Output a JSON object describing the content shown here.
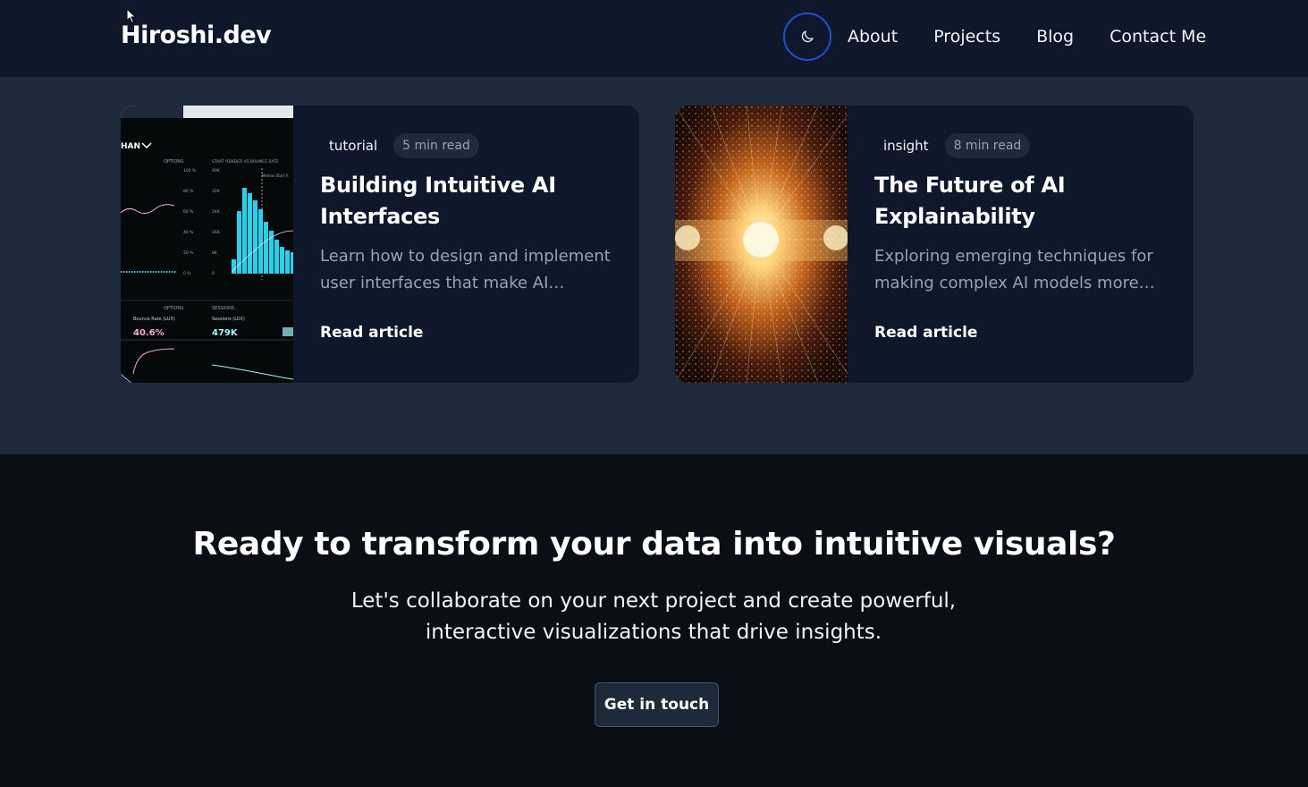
{
  "nav": {
    "brand": "Hiroshi.dev",
    "theme_toggle_icon": "moon-icon",
    "links": [
      {
        "label": "About"
      },
      {
        "label": "Projects"
      },
      {
        "label": "Blog"
      },
      {
        "label": "Contact Me"
      }
    ]
  },
  "articles": [
    {
      "tag": "tutorial",
      "read_time": "5 min read",
      "title": "Building Intuitive AI Interfaces",
      "excerpt": "Learn how to design and implement user interfaces that make AI systems more accessible and understandable.",
      "link_label": "Read article",
      "thumbnail": "analytics-dashboard-image",
      "thumbnail_text": {
        "dropdown": "HAN",
        "options_top": "OPTIONS",
        "chart_title": "START RENDER VS BOUNCE RATE",
        "median": "Median Start R",
        "y_ticks_pct": [
          "100 %",
          "80 %",
          "60 %",
          "40 %",
          "20 %",
          "0 %"
        ],
        "y_ticks_k": [
          "40K",
          "32K",
          "24K",
          "16K",
          "8K",
          "0"
        ],
        "options_bottom": "OPTIONS",
        "sessions": "SESSIONS",
        "bounce_label": "Bounce Rate (LUX)",
        "bounce_value": "40.6%",
        "sessions_label": "Sessions (LUX)",
        "sessions_value": "479K"
      }
    },
    {
      "tag": "insight",
      "read_time": "8 min read",
      "title": "The Future of AI Explainability",
      "excerpt": "Exploring emerging techniques for making complex AI models more transparent and interpretable.",
      "link_label": "Read article",
      "thumbnail": "light-tunnel-image"
    }
  ],
  "cta": {
    "title": "Ready to transform your data into intuitive visuals?",
    "subtitle": "Let's collaborate on your next project and create powerful, interactive visualizations that drive insights.",
    "button_label": "Get in touch"
  },
  "colors": {
    "nav_bg": "#0f172a",
    "section_bg": "#1e293b",
    "card_bg": "#0f172a",
    "cta_bg": "#0b0e14",
    "toggle_ring": "#1d4ed8",
    "muted_text": "#94a3b8",
    "chart_cyan": "#22d3ee"
  }
}
